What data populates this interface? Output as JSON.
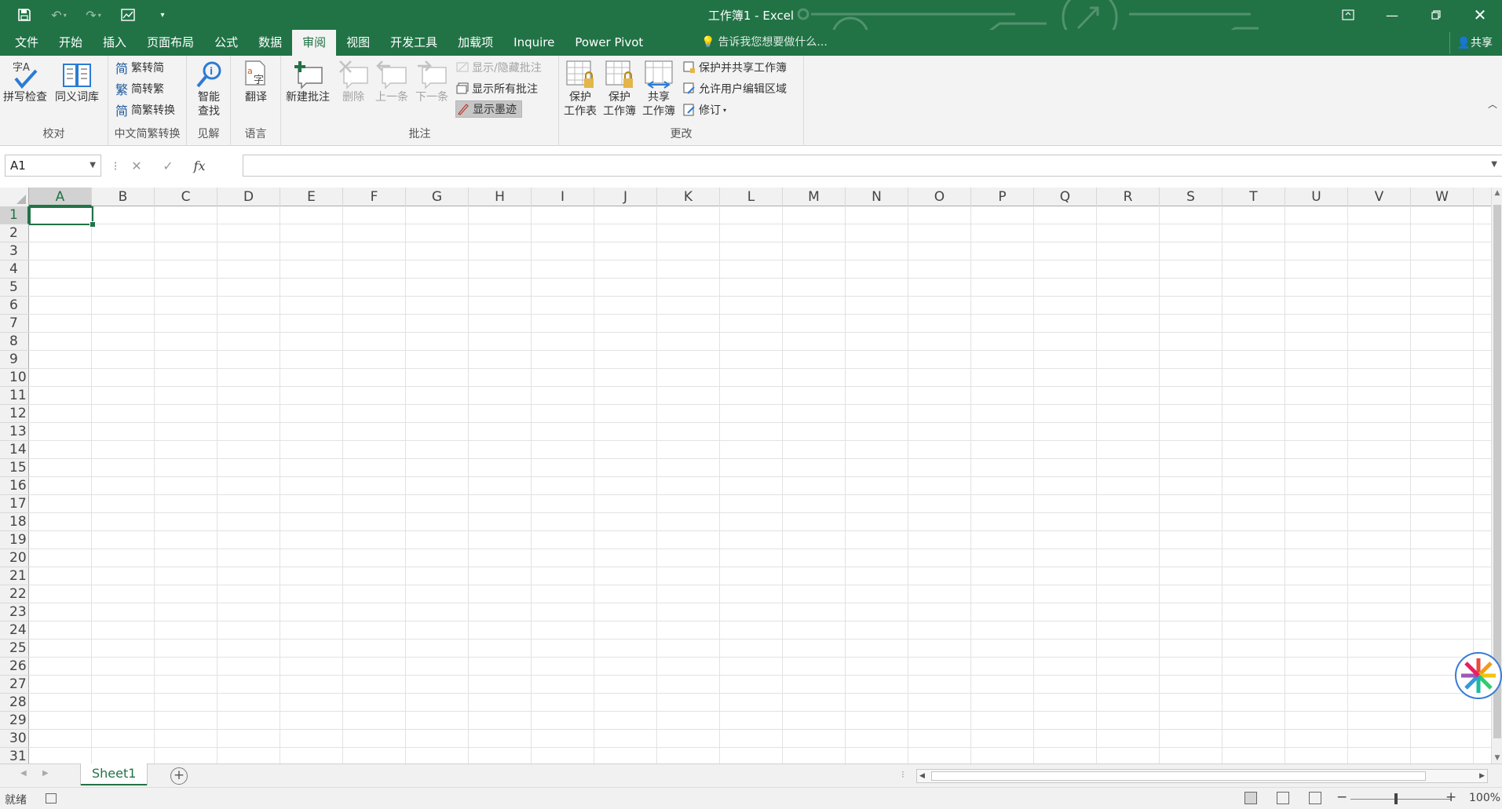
{
  "window": {
    "title": "工作簿1 - Excel",
    "share_label": "共享"
  },
  "ribbon_tabs": [
    "文件",
    "开始",
    "插入",
    "页面布局",
    "公式",
    "数据",
    "审阅",
    "视图",
    "开发工具",
    "加载项",
    "Inquire",
    "Power Pivot"
  ],
  "active_tab": "审阅",
  "tell_me": "告诉我您想要做什么...",
  "ribbon": {
    "proofing": {
      "label": "校对",
      "spelling": "拼写检查",
      "thesaurus": "同义词库"
    },
    "chinese": {
      "label": "中文简繁转换",
      "to_simplified": "繁转简",
      "to_traditional": "简转繁",
      "convert": "简繁转换"
    },
    "insights": {
      "label": "见解",
      "smart_lookup_1": "智能",
      "smart_lookup_2": "查找"
    },
    "language": {
      "label": "语言",
      "translate": "翻译"
    },
    "comments": {
      "label": "批注",
      "new": "新建批注",
      "delete": "删除",
      "previous": "上一条",
      "next": "下一条",
      "show_hide": "显示/隐藏批注",
      "show_all": "显示所有批注",
      "show_ink": "显示墨迹"
    },
    "changes": {
      "label": "更改",
      "protect_sheet_1": "保护",
      "protect_sheet_2": "工作表",
      "protect_wb_1": "保护",
      "protect_wb_2": "工作簿",
      "share_wb_1": "共享",
      "share_wb_2": "工作簿",
      "protect_share": "保护并共享工作簿",
      "allow_edit": "允许用户编辑区域",
      "track": "修订"
    }
  },
  "formula_bar": {
    "name_box": "A1",
    "fx": "fx",
    "value": ""
  },
  "grid": {
    "columns": [
      "A",
      "B",
      "C",
      "D",
      "E",
      "F",
      "G",
      "H",
      "I",
      "J",
      "K",
      "L",
      "M",
      "N",
      "O",
      "P",
      "Q",
      "R",
      "S",
      "T",
      "U",
      "V",
      "W"
    ],
    "rows": [
      "1",
      "2",
      "3",
      "4",
      "5",
      "6",
      "7",
      "8",
      "9",
      "10",
      "11",
      "12",
      "13",
      "14",
      "15",
      "16",
      "17",
      "18",
      "19",
      "20",
      "21",
      "22",
      "23",
      "24",
      "25",
      "26",
      "27",
      "28",
      "29",
      "30",
      "31"
    ],
    "active_cell": "A1"
  },
  "sheets": {
    "tabs": [
      "Sheet1"
    ],
    "active": "Sheet1"
  },
  "status": {
    "text": "就绪",
    "zoom": "100%"
  },
  "colors": {
    "accent": "#217346",
    "ribbon_bg": "#f3f3f3",
    "grid_line": "#e2e2e2"
  }
}
